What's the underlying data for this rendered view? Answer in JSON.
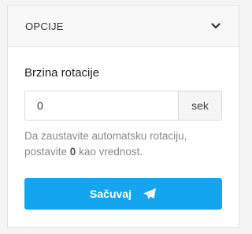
{
  "panel": {
    "title": "OPCIJE",
    "toggle_icon": "chevron-down-icon"
  },
  "rotation": {
    "label": "Brzina rotacije",
    "value": "0",
    "unit": "sek",
    "help_prefix": "Da zaustavite automatsku rotaciju, postavite ",
    "help_value": "0",
    "help_suffix": " kao vrednost."
  },
  "actions": {
    "save_label": "Sačuvaj",
    "save_icon": "paper-plane-icon"
  },
  "colors": {
    "accent": "#14a5ef",
    "text": "#222222",
    "muted": "#8a8a8a"
  }
}
